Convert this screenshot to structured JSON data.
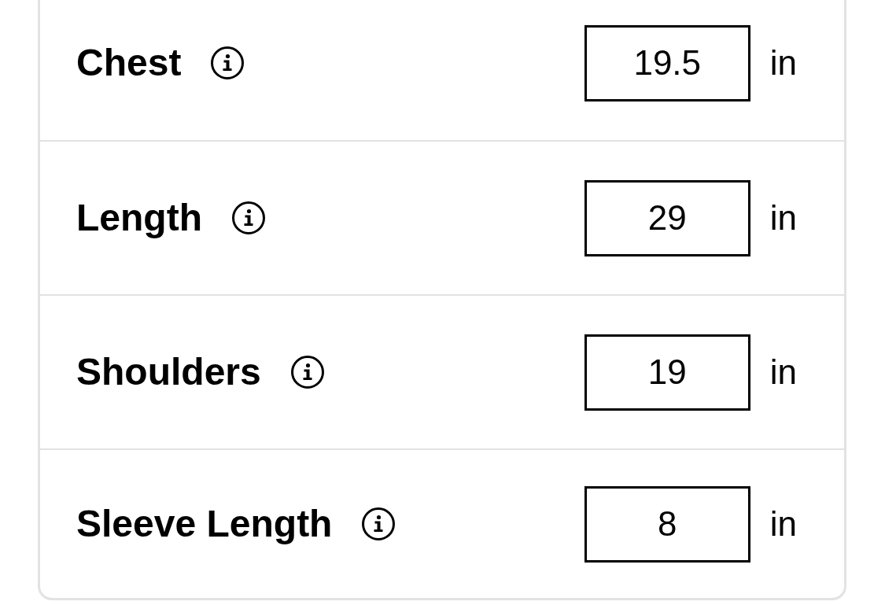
{
  "measurements": [
    {
      "label": "Chest",
      "value": "19.5",
      "unit": "in"
    },
    {
      "label": "Length",
      "value": "29",
      "unit": "in"
    },
    {
      "label": "Shoulders",
      "value": "19",
      "unit": "in"
    },
    {
      "label": "Sleeve Length",
      "value": "8",
      "unit": "in"
    }
  ]
}
